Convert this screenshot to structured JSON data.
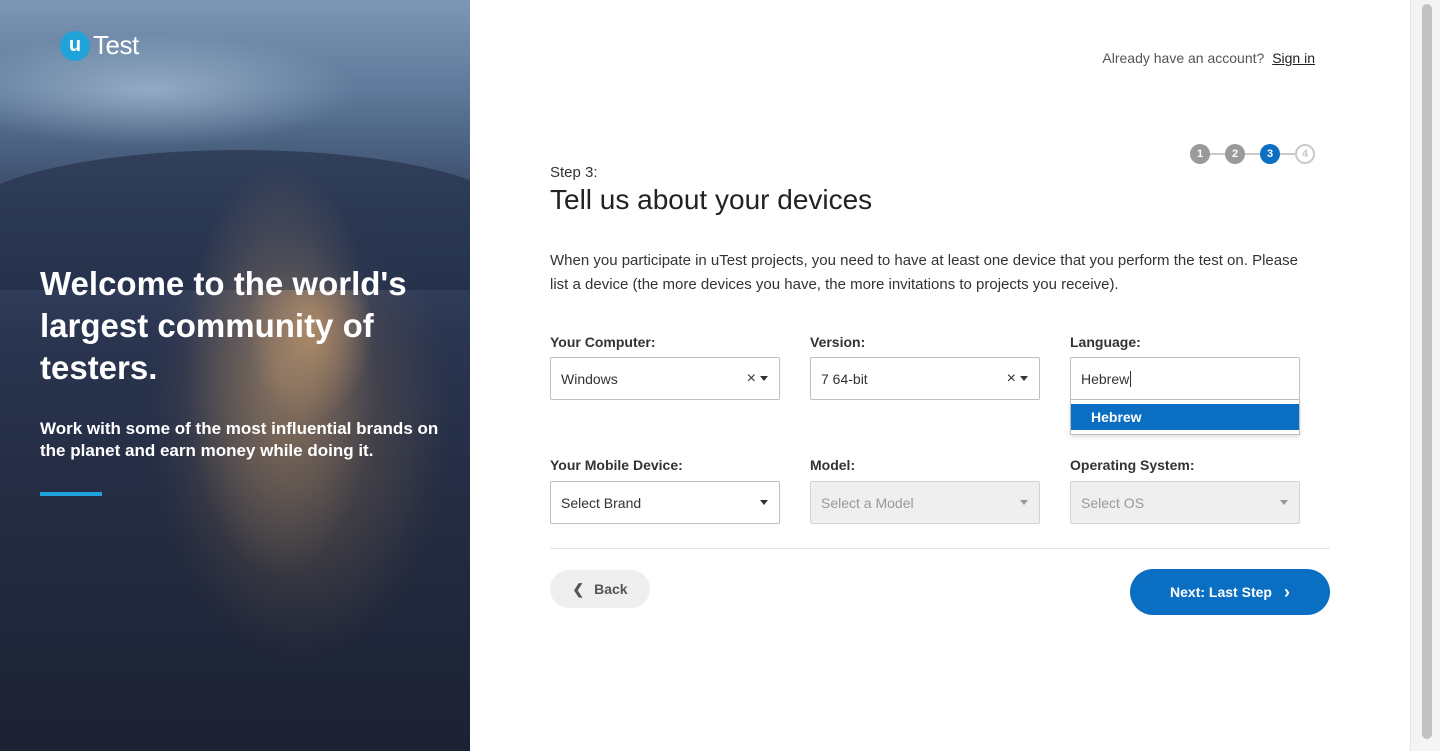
{
  "hero": {
    "logo_letter": "u",
    "logo_text": "Test",
    "title": "Welcome to the world's largest community of testers.",
    "subtitle": "Work with some of the most influential brands on the planet and earn money while doing it.",
    "accent_color": "#1fa3d8"
  },
  "header": {
    "account_prompt": "Already have an account?",
    "sign_in_label": "Sign in"
  },
  "stepper": {
    "steps": [
      "1",
      "2",
      "3",
      "4"
    ],
    "current": 3
  },
  "main": {
    "step_label": "Step 3:",
    "title": "Tell us about your devices",
    "intro": "When you participate in uTest projects, you need to have at least one device that you perform the test on. Please list a device (the more devices you have, the more invitations to projects you receive)."
  },
  "computer": {
    "label": "Your Computer:",
    "value": "Windows",
    "clear_icon": "×"
  },
  "version": {
    "label": "Version:",
    "value": "7 64-bit",
    "clear_icon": "×"
  },
  "language": {
    "label": "Language:",
    "value": "Hebrew",
    "options": [
      "Hebrew"
    ]
  },
  "mobile": {
    "label": "Your Mobile Device:",
    "placeholder": "Select Brand"
  },
  "model": {
    "label": "Model:",
    "placeholder": "Select a Model"
  },
  "os": {
    "label": "Operating System:",
    "placeholder": "Select OS"
  },
  "actions": {
    "back_label": "Back",
    "next_label": "Next: Last Step"
  },
  "colors": {
    "primary": "#0a6fc2",
    "step_done": "#9a9a9a"
  }
}
